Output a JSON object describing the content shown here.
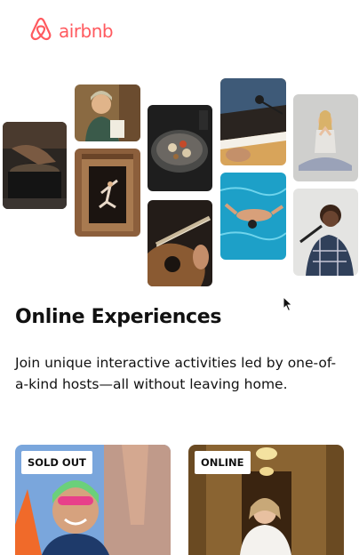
{
  "brand": {
    "name": "airbnb",
    "color": "#ff5a5f",
    "icon": "airbnb-belo-logo-icon"
  },
  "gallery": {
    "tiles": [
      {
        "subject": "cooking-pot-photo"
      },
      {
        "subject": "smiling-host-photo"
      },
      {
        "subject": "dancer-doorway-photo"
      },
      {
        "subject": "food-bowl-photo"
      },
      {
        "subject": "guitar-photo"
      },
      {
        "subject": "piano-microphone-photo"
      },
      {
        "subject": "swimmer-pool-photo"
      },
      {
        "subject": "yoga-photo"
      },
      {
        "subject": "singer-photo"
      }
    ]
  },
  "hero": {
    "title": "Online Experiences",
    "subtitle": "Join unique interactive activities led by one-of-a-kind hosts—all without leaving home."
  },
  "cards": [
    {
      "badge": "SOLD OUT",
      "subject": "swimmer-portrait-photo"
    },
    {
      "badge": "ONLINE",
      "subject": "bride-portrait-photo"
    }
  ],
  "cursor": {
    "icon": "mouse-pointer-icon"
  }
}
